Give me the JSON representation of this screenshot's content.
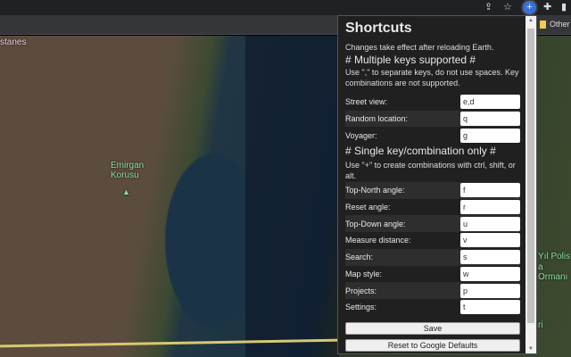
{
  "browser": {
    "bookmark_other": "Other",
    "extension_icon": "earth-plus-icon"
  },
  "map": {
    "labels": [
      "stanes",
      "Emirgan",
      "Korusu",
      "Yıl Polis",
      "a Ormanı",
      "ri"
    ]
  },
  "popup": {
    "title": "Shortcuts",
    "note": "Changes take effect after reloading Earth.",
    "multi_header": "# Multiple keys supported #",
    "multi_desc": "Use \",\" to separate keys, do not use spaces. Key combinations are not supported.",
    "multi_rows": [
      {
        "label": "Street view:",
        "value": "e,d"
      },
      {
        "label": "Random location:",
        "value": "q"
      },
      {
        "label": "Voyager:",
        "value": "g"
      }
    ],
    "single_header": "# Single key/combination only #",
    "single_desc": "Use \"+\" to create combinations with ctrl, shift, or alt.",
    "single_rows": [
      {
        "label": "Top-North angle:",
        "value": "f"
      },
      {
        "label": "Reset angle:",
        "value": "r"
      },
      {
        "label": "Top-Down angle:",
        "value": "u"
      },
      {
        "label": "Measure distance:",
        "value": "v"
      },
      {
        "label": "Search:",
        "value": "s"
      },
      {
        "label": "Map style:",
        "value": "w"
      },
      {
        "label": "Projects:",
        "value": "p"
      },
      {
        "label": "Settings:",
        "value": "t"
      }
    ],
    "save_label": "Save",
    "reset_label": "Reset to Google Defaults"
  }
}
